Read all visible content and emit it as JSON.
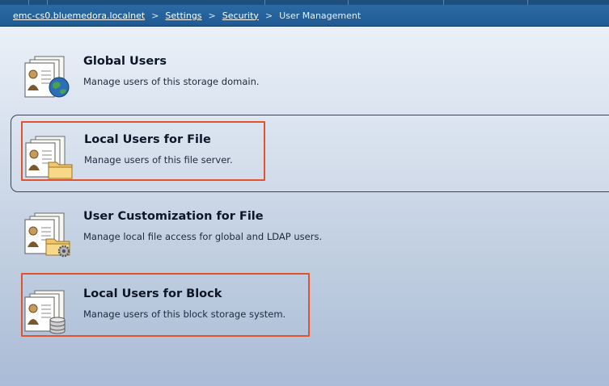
{
  "breadcrumb": {
    "items": [
      "emc-cs0.bluemedora.localnet",
      "Settings",
      "Security"
    ],
    "current": "User Management",
    "separator": ">"
  },
  "list": [
    {
      "title": "Global Users",
      "description": "Manage users of this storage domain.",
      "icon": "users-globe-icon"
    },
    {
      "title": "Local Users for File",
      "description": "Manage users of this file server.",
      "icon": "users-folder-icon"
    },
    {
      "title": "User Customization for File",
      "description": "Manage local file access for global and LDAP users.",
      "icon": "users-folder-gear-icon"
    },
    {
      "title": "Local Users for Block",
      "description": "Manage users of this block storage system.",
      "icon": "users-database-icon"
    }
  ],
  "colors": {
    "header": "#1f5a93",
    "highlight": "#e0532e"
  }
}
